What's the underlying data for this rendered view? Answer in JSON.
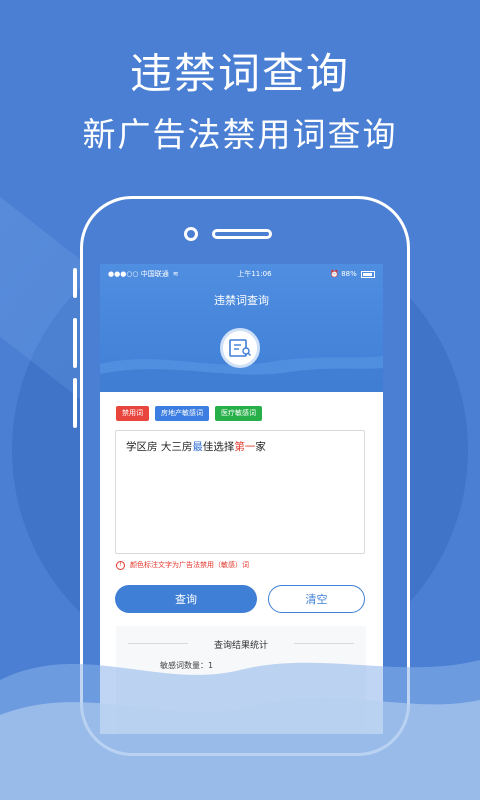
{
  "headline": "违禁词查询",
  "subheadline": "新广告法禁用词查询",
  "status_bar": {
    "carrier": "●●●○○ 中国联通",
    "time": "上午11:06",
    "battery": "88%"
  },
  "app": {
    "title": "违禁词查询"
  },
  "tags": [
    {
      "label": "禁用词",
      "color": "#e8463c"
    },
    {
      "label": "房地产敏感词",
      "color": "#3b7de0"
    },
    {
      "label": "医疗敏感词",
      "color": "#27b04a"
    }
  ],
  "input_text": {
    "part1": "学区房  大三房",
    "part2": "最",
    "part3": "佳选择",
    "part4": "第一",
    "part5": "家"
  },
  "notice": "颜色标注文字为广告法禁用（敏感）词",
  "buttons": {
    "query": "查询",
    "clear": "清空"
  },
  "result": {
    "title": "查询结果统计",
    "stat": "敏感词数量：1"
  },
  "colors": {
    "accent": "#3f7fd6",
    "background": "#4a7fd3",
    "alert": "#e3372c"
  }
}
